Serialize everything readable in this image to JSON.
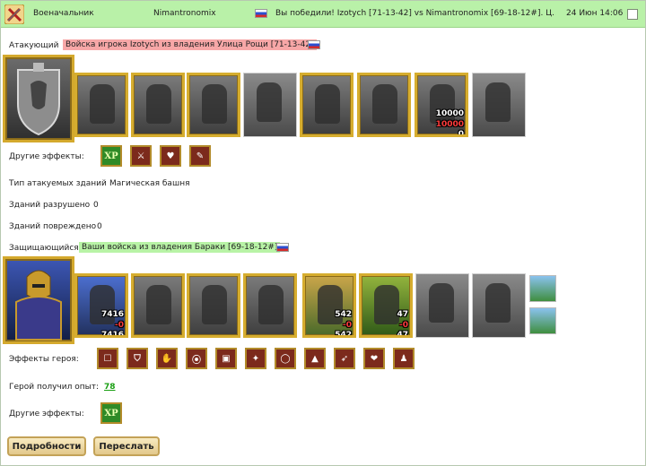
{
  "header": {
    "role": "Военачальник",
    "player": "Nimantronomix",
    "result": "Вы победили! Izotych [71-13-42] vs Nimantronomix [69-18-12#]. Ц...",
    "date": "24 Июн 14:06",
    "icon": "battle-swords-icon"
  },
  "attacker": {
    "label": "Атакующий",
    "army": "Войска игрока Izotych из владения Улица Рощи [71-13-42]",
    "hero_icon": "lion-shield-icon",
    "units": [
      {
        "icon": "knight-unit-icon"
      },
      {
        "icon": "cavalry-unit-icon"
      },
      {
        "icon": "lancer-unit-icon"
      },
      {
        "icon": "griffin-unit-icon",
        "plain": true
      },
      {
        "icon": "crossbowman-unit-icon"
      },
      {
        "icon": "monk-unit-icon"
      },
      {
        "icon": "angel-unit-icon",
        "count_top": "10000",
        "count_mid": "10000",
        "count_bot": "0"
      },
      {
        "icon": "ghost-unit-icon",
        "plain": true
      }
    ],
    "other_effects_label": "Другие эффекты:",
    "effects": [
      "XP",
      "⚔",
      "♥",
      "✎"
    ],
    "building_type_label": "Тип атакуемых зданий",
    "building_type_value": "Магическая башня",
    "destroyed_label": "Зданий разрушено",
    "destroyed_value": "0",
    "damaged_label": "Зданий повреждено",
    "damaged_value": "0"
  },
  "defender": {
    "label": "Защищающийся",
    "army": "Ваши войска из владения Бараки [69-18-12#]",
    "hero_icon": "armored-hero-icon",
    "units": [
      {
        "icon": "priest-unit-icon",
        "colored": "colored",
        "count_top": "7416",
        "count_mid": "-0",
        "count_bot": "7416"
      },
      {
        "icon": "cavalry-unit-icon"
      },
      {
        "icon": "lancer-unit-icon"
      },
      {
        "icon": "griffin-unit-icon"
      },
      {
        "icon": "crossbowman-unit-icon",
        "colored": "colored2",
        "count_top": "542",
        "count_mid": "-0",
        "count_bot": "542"
      },
      {
        "icon": "mage-unit-icon",
        "colored": "colored3",
        "count_top": "47",
        "count_mid": "-0",
        "count_bot": "47"
      },
      {
        "icon": "warrior-unit-icon",
        "plain": true
      },
      {
        "icon": "ghost-unit-icon",
        "plain": true
      }
    ],
    "buildings": [
      "tower-building-icon",
      "fountain-building-icon"
    ],
    "hero_effects_label": "Эффекты героя:",
    "hero_effects": [
      "☐",
      "⛉",
      "✋",
      "⦿",
      "▣",
      "✦",
      "◯",
      "▲",
      "➶",
      "❤",
      "♟"
    ],
    "exp_label": "Герой получил опыт:",
    "exp_value": "78",
    "other_effects_label": "Другие эффекты:",
    "effects": [
      "XP"
    ]
  },
  "buttons": {
    "details": "Подробности",
    "forward": "Переслать"
  }
}
